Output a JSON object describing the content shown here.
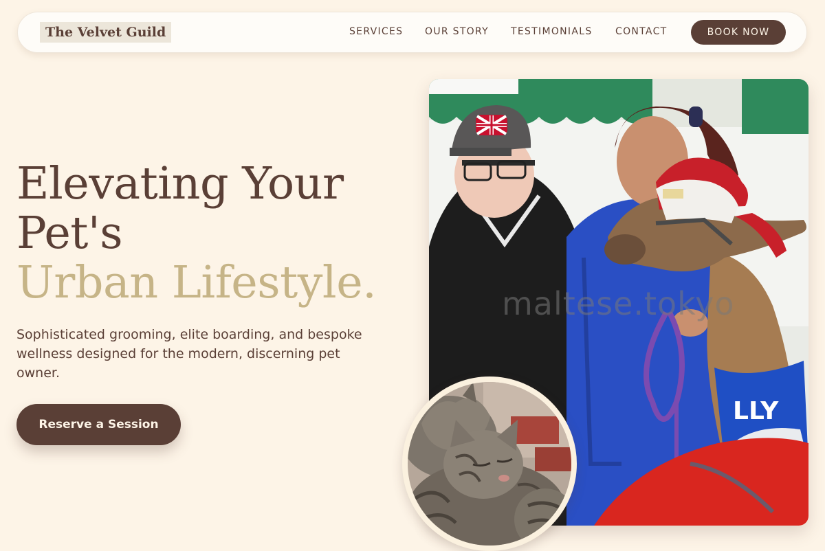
{
  "brand": {
    "name": "The Velvet Guild"
  },
  "nav": {
    "links": [
      {
        "label": "SERVICES"
      },
      {
        "label": "OUR STORY"
      },
      {
        "label": "TESTIMONIALS"
      },
      {
        "label": "CONTACT"
      }
    ],
    "cta_label": "BOOK NOW"
  },
  "hero": {
    "headline_line1": "Elevating Your",
    "headline_line2": "Pet's",
    "headline_accent": "Urban Lifestyle.",
    "subtext": "Sophisticated grooming, elite boarding, and bespoke wellness designed for the modern, discerning pet owner.",
    "cta_label": "Reserve a Session"
  },
  "images": {
    "main_watermark": "maltese.tokyo",
    "alpaca_sweater_text": "LLY"
  },
  "colors": {
    "background": "#fdf4e7",
    "primary": "#5a3f36",
    "accent": "#c6b487",
    "nav_bg": "#fefcf8"
  }
}
